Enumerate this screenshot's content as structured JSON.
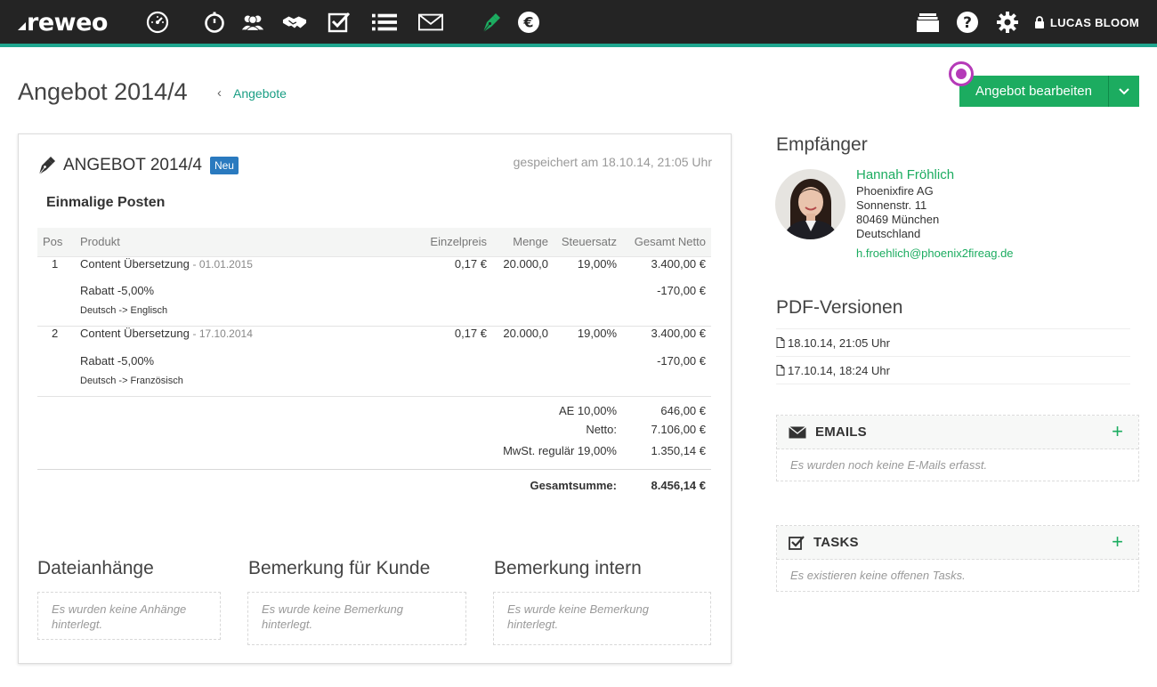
{
  "app": {
    "logo_text": "reweo",
    "user_name": "LUCAS BLOOM"
  },
  "nav": {
    "icons": [
      "dashboard-icon",
      "timer-icon",
      "contacts-icon",
      "deals-icon",
      "tasks-icon",
      "list-icon",
      "mail-icon",
      "offer-pen-icon",
      "euro-icon"
    ]
  },
  "header": {
    "title": "Angebot 2014/4",
    "breadcrumb": "Angebote",
    "edit_button": "Angebot bearbeiten"
  },
  "offer": {
    "title": "ANGEBOT 2014/4",
    "status_badge": "Neu",
    "saved_text": "gespeichert am 18.10.14, 21:05 Uhr",
    "section_title": "Einmalige Posten",
    "columns": {
      "pos": "Pos",
      "product": "Produkt",
      "unit_price": "Einzelpreis",
      "quantity": "Menge",
      "tax": "Steuersatz",
      "total": "Gesamt Netto"
    },
    "items": [
      {
        "pos": "1",
        "product": "Content Übersetzung",
        "date": "- 01.01.2015",
        "unit_price": "0,17 €",
        "quantity": "20.000,0",
        "tax": "19,00%",
        "total": "3.400,00 €",
        "discount_label": "Rabatt -5,00%",
        "discount_value": "-170,00 €",
        "note": "Deutsch -> Englisch"
      },
      {
        "pos": "2",
        "product": "Content Übersetzung",
        "date": "- 17.10.2014",
        "unit_price": "0,17 €",
        "quantity": "20.000,0",
        "tax": "19,00%",
        "total": "3.400,00 €",
        "discount_label": "Rabatt -5,00%",
        "discount_value": "-170,00 €",
        "note": "Deutsch -> Französisch"
      }
    ],
    "totals": [
      {
        "label": "AE 10,00%",
        "value": "646,00 €"
      },
      {
        "label": "Netto:",
        "value": "7.106,00 €"
      },
      {
        "label": "MwSt. regulär 19,00%",
        "value": "1.350,14 €"
      }
    ],
    "grand_total": {
      "label": "Gesamtsumme:",
      "value": "8.456,14 €"
    },
    "attachments": {
      "title": "Dateianhänge",
      "empty": "Es wurden keine Anhänge hinterlegt."
    },
    "customer_note": {
      "title": "Bemerkung für Kunde",
      "empty": "Es wurde keine Bemerkung hinterlegt."
    },
    "internal_note": {
      "title": "Bemerkung intern",
      "empty": "Es wurde keine Bemerkung hinterlegt."
    }
  },
  "recipient": {
    "heading": "Empfänger",
    "name": "Hannah Fröhlich",
    "company": "Phoenixfire AG",
    "street": "Sonnenstr. 11",
    "city": "80469 München",
    "country": "Deutschland",
    "email": "h.froehlich@phoenix2fireag.de"
  },
  "pdf_versions": {
    "heading": "PDF-Versionen",
    "items": [
      "18.10.14, 21:05 Uhr",
      "17.10.14, 18:24 Uhr"
    ]
  },
  "emails_panel": {
    "title": "EMAILS",
    "empty": "Es wurden noch keine E-Mails erfasst."
  },
  "tasks_panel": {
    "title": "TASKS",
    "empty": "Es existieren keine offenen Tasks."
  },
  "colors": {
    "accent": "#1cac60",
    "teal": "#1fa68f",
    "badge": "#2a7abf",
    "topbar": "#242424",
    "cursor_marker": "#b53ab8"
  }
}
